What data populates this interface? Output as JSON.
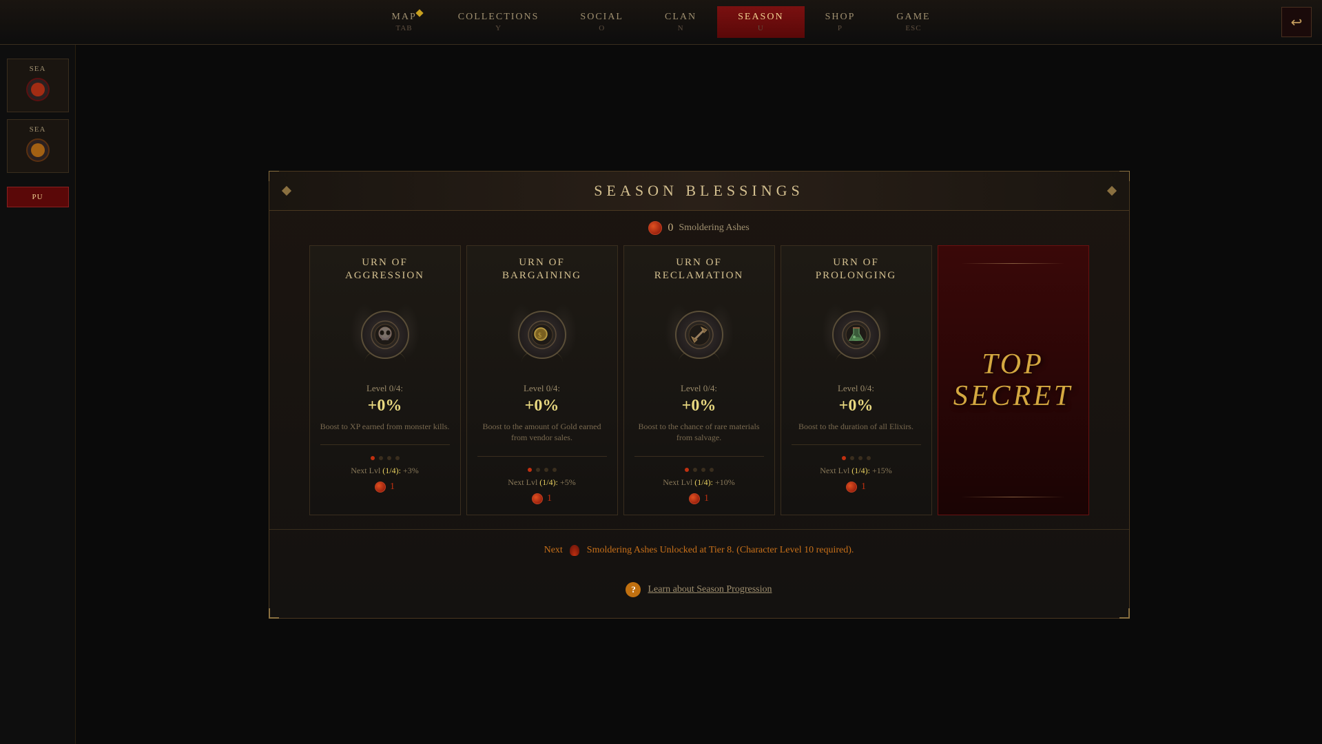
{
  "nav": {
    "items": [
      {
        "id": "map",
        "label": "MAP",
        "key": "TAB",
        "active": false,
        "has_diamond": true
      },
      {
        "id": "collections",
        "label": "COLLECTIONS",
        "key": "Y",
        "active": false
      },
      {
        "id": "social",
        "label": "SOCIAL",
        "key": "O",
        "active": false
      },
      {
        "id": "clan",
        "label": "CLAN",
        "key": "N",
        "active": false
      },
      {
        "id": "season",
        "label": "SEASON",
        "key": "U",
        "active": true
      },
      {
        "id": "shop",
        "label": "SHOP",
        "key": "P",
        "active": false
      },
      {
        "id": "game",
        "label": "GAME",
        "key": "ESC",
        "active": false
      }
    ]
  },
  "panel": {
    "title": "SEASON BLESSINGS",
    "ashes": {
      "count": "0",
      "label": "Smoldering Ashes"
    },
    "cards": [
      {
        "id": "aggression",
        "title": "URN OF\nAGGRESSION",
        "icon": "💀",
        "level": "Level 0/4:",
        "percent": "+0%",
        "desc": "Boost to XP earned from monster kills.",
        "next_lvl": "Next Lvl (1/4): +3%",
        "cost": "1"
      },
      {
        "id": "bargaining",
        "title": "URN OF\nBARGAINING",
        "icon": "🪙",
        "level": "Level 0/4:",
        "percent": "+0%",
        "desc": "Boost to the amount of Gold earned from vendor sales.",
        "next_lvl": "Next Lvl (1/4): +5%",
        "cost": "1"
      },
      {
        "id": "reclamation",
        "title": "URN OF\nRECLAMATION",
        "icon": "⚒",
        "level": "Level 0/4:",
        "percent": "+0%",
        "desc": "Boost to the chance of rare materials from salvage.",
        "next_lvl": "Next Lvl (1/4): +10%",
        "cost": "1"
      },
      {
        "id": "prolonging",
        "title": "URN OF\nPROLONGING",
        "icon": "⚗",
        "level": "Level 0/4:",
        "percent": "+0%",
        "desc": "Boost to the duration of all Elixirs.",
        "next_lvl": "Next Lvl (1/4): +15%",
        "cost": "1"
      }
    ],
    "secret": {
      "title": "TOP\nSECRET"
    },
    "bottom_info": "Next   🔥  Smoldering Ashes Unlocked at Tier 8.  (Character Level 10 required).",
    "learn_link": "Learn about Season Progression"
  },
  "sidebar": {
    "items": [
      {
        "id": "sea1",
        "label": "SEA"
      },
      {
        "id": "sea2",
        "label": "SEA"
      }
    ],
    "button": "PU"
  }
}
